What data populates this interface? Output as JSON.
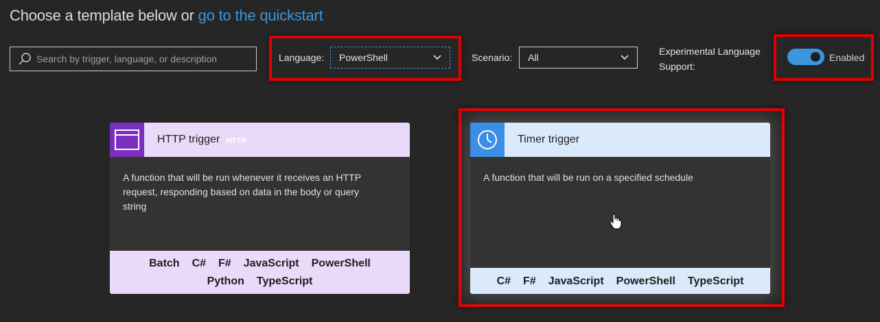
{
  "heading": {
    "prefix": "Choose a template below or ",
    "link": "go to the quickstart"
  },
  "search": {
    "placeholder": "Search by trigger, language, or description",
    "value": ""
  },
  "filters": {
    "language_label": "Language:",
    "language_value": "PowerShell",
    "scenario_label": "Scenario:",
    "scenario_value": "All",
    "experimental_label_line1": "Experimental Language",
    "experimental_label_line2": "Support:",
    "toggle_state": "Enabled"
  },
  "cards": [
    {
      "title": "HTTP trigger",
      "icon": "http-icon",
      "icon_text": "HTTP",
      "description": "A function that will be run whenever it receives an HTTP request, responding based on data in the body or query string",
      "languages": [
        "Batch",
        "C#",
        "F#",
        "JavaScript",
        "PowerShell",
        "Python",
        "TypeScript"
      ]
    },
    {
      "title": "Timer trigger",
      "icon": "clock-icon",
      "description": "A function that will be run on a specified schedule",
      "languages": [
        "C#",
        "F#",
        "JavaScript",
        "PowerShell",
        "TypeScript"
      ]
    }
  ],
  "colors": {
    "background": "#262626",
    "link": "#3a96dd",
    "highlight": "#e00000",
    "http_accent": "#7b2fbf",
    "http_tint": "#ead9f8",
    "timer_accent": "#3a8ee6",
    "timer_tint": "#dbeafb"
  }
}
